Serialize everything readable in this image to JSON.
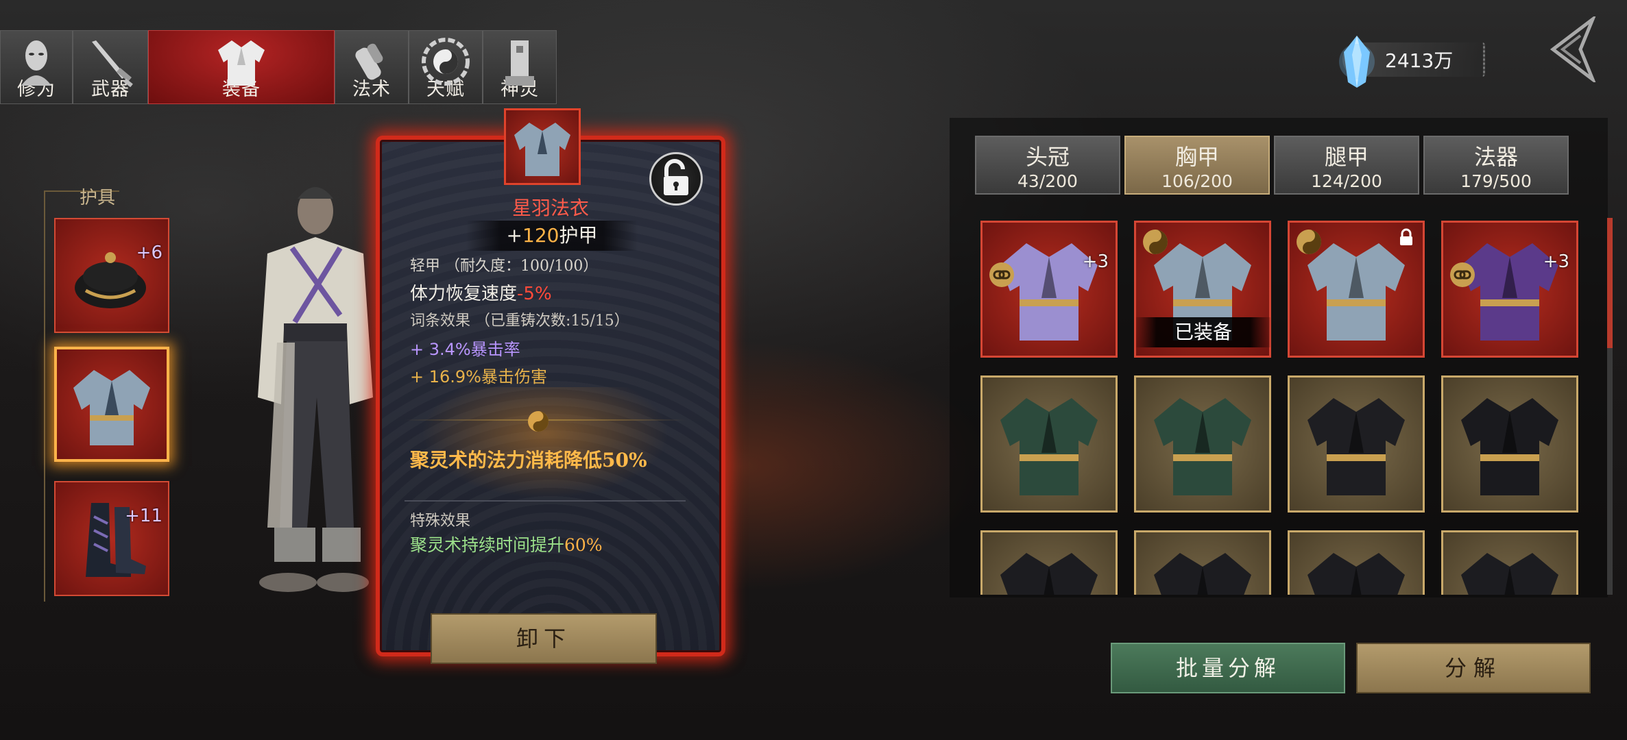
{
  "tabs": [
    {
      "label": "修为",
      "icon": "face-mask-icon",
      "active": false
    },
    {
      "label": "武器",
      "icon": "sword-icon",
      "active": false
    },
    {
      "label": "装备",
      "icon": "robe-icon",
      "active": true
    },
    {
      "label": "法术",
      "icon": "scroll-icon",
      "active": false
    },
    {
      "label": "天赋",
      "icon": "bagua-icon",
      "active": false
    },
    {
      "label": "神灵",
      "icon": "tablet-icon",
      "active": false
    }
  ],
  "currency": {
    "amount": "2413万",
    "icon": "spirit-crystal-icon"
  },
  "armor_panel": {
    "title": "护具",
    "slots": [
      {
        "icon": "hat-icon",
        "plus": "+6"
      },
      {
        "icon": "robe-icon",
        "plus": ""
      },
      {
        "icon": "boots-icon",
        "plus": "+11"
      }
    ]
  },
  "detail": {
    "name": "星羽法衣",
    "armor_prefix": "+",
    "armor_value": "120",
    "armor_suffix": "护甲",
    "type_line": "轻甲 （耐久度：100/100）",
    "stamina_label": "体力恢复速度",
    "stamina_value": "-5%",
    "affix_title": "词条效果 （已重铸次数:15/15）",
    "affixes": [
      {
        "sign": "+ 3.4%",
        "text": "暴击率"
      },
      {
        "sign": "+ 16.9%",
        "text": "暴击伤害"
      }
    ],
    "set_effect": "聚灵术的法力消耗降低50%",
    "special_title": "特殊效果",
    "special_text": "聚灵术持续时间提升",
    "special_value": "60%",
    "unequip_label": "卸下"
  },
  "categories": [
    {
      "name": "头冠",
      "count": "43/200",
      "active": false
    },
    {
      "name": "胸甲",
      "count": "106/200",
      "active": true
    },
    {
      "name": "腿甲",
      "count": "124/200",
      "active": false
    },
    {
      "name": "法器",
      "count": "179/500",
      "active": false
    }
  ],
  "inventory": [
    {
      "rarity": "red",
      "plus": "+3",
      "chain": true,
      "yinyang": false,
      "lock": false,
      "equipped": ""
    },
    {
      "rarity": "red",
      "plus": "",
      "chain": false,
      "yinyang": true,
      "lock": false,
      "equipped": "已装备"
    },
    {
      "rarity": "red",
      "plus": "",
      "chain": false,
      "yinyang": true,
      "lock": true,
      "equipped": ""
    },
    {
      "rarity": "red",
      "plus": "+3",
      "chain": true,
      "yinyang": false,
      "lock": false,
      "equipped": ""
    },
    {
      "rarity": "gold",
      "plus": "",
      "chain": false,
      "yinyang": false,
      "lock": false,
      "equipped": ""
    },
    {
      "rarity": "gold",
      "plus": "",
      "chain": false,
      "yinyang": false,
      "lock": false,
      "equipped": ""
    },
    {
      "rarity": "gold",
      "plus": "",
      "chain": false,
      "yinyang": false,
      "lock": false,
      "equipped": ""
    },
    {
      "rarity": "gold",
      "plus": "",
      "chain": false,
      "yinyang": false,
      "lock": false,
      "equipped": ""
    },
    {
      "rarity": "gold",
      "plus": "",
      "chain": false,
      "yinyang": false,
      "lock": false,
      "equipped": ""
    },
    {
      "rarity": "gold",
      "plus": "",
      "chain": false,
      "yinyang": false,
      "lock": false,
      "equipped": ""
    },
    {
      "rarity": "gold",
      "plus": "",
      "chain": false,
      "yinyang": false,
      "lock": false,
      "equipped": ""
    },
    {
      "rarity": "gold",
      "plus": "",
      "chain": false,
      "yinyang": false,
      "lock": false,
      "equipped": ""
    }
  ],
  "actions": {
    "batch_label": "批量分解",
    "decompose_label": "分解"
  },
  "colors": {
    "red_quality": "#b62c1e",
    "gold_quality": "#c9a96a",
    "accent_orange": "#ffb347",
    "affix_purple": "#b996ff"
  }
}
